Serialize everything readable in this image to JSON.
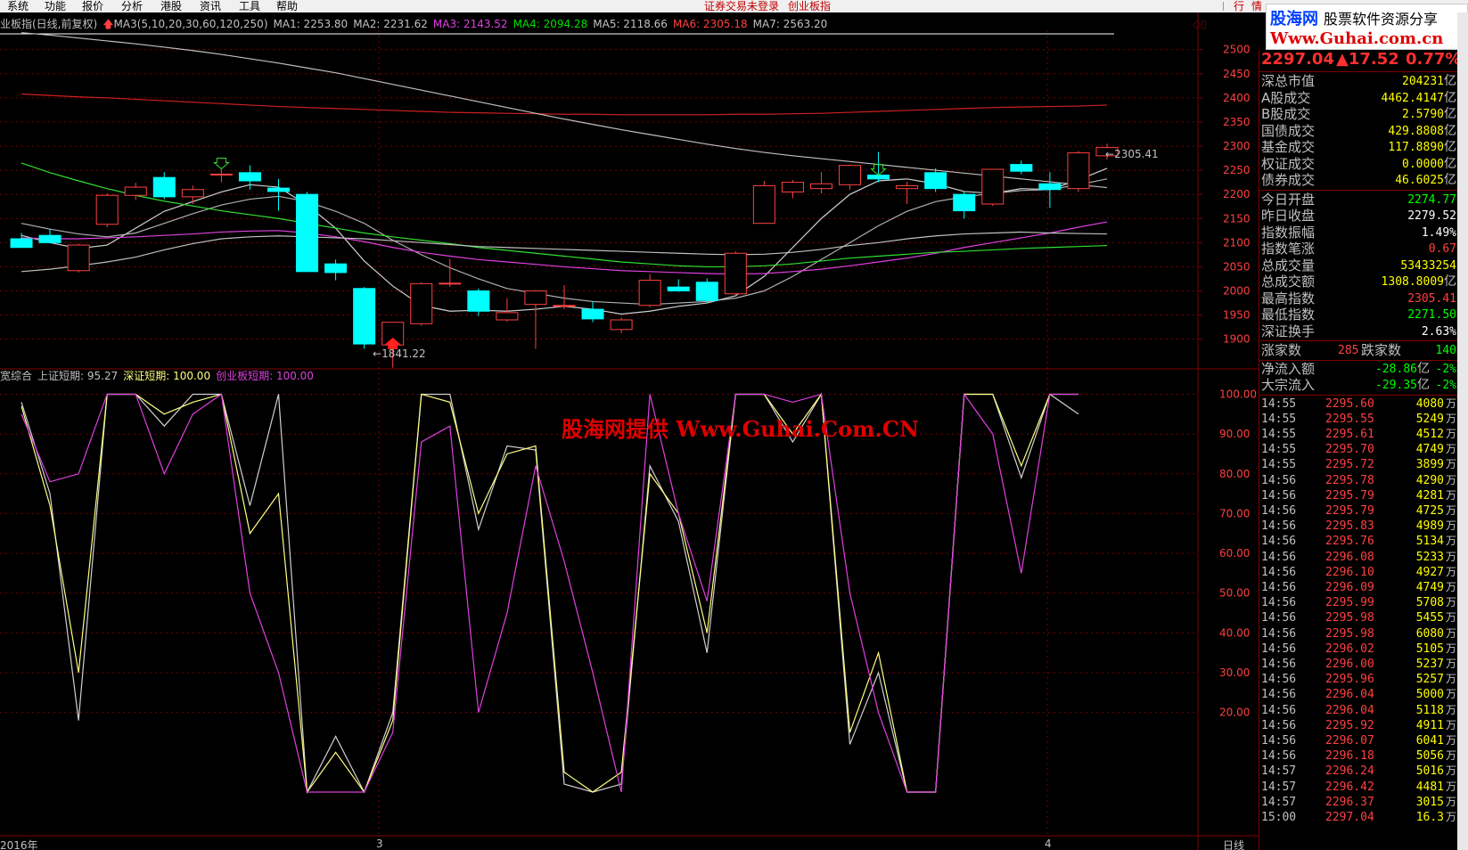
{
  "menu": {
    "items": [
      "系统",
      "功能",
      "报价",
      "分析",
      "港股",
      "资讯",
      "工具",
      "帮助"
    ],
    "status_text": "证券交易未登录",
    "status_text2": "创业板指",
    "right_items": [
      "行",
      "情"
    ]
  },
  "logo": {
    "line1_a": "股海网",
    "line1_b": "股票软件资源分享",
    "line2": "Www.Guhai.com.cn"
  },
  "main_legend": {
    "title": "业板指(日线,前复权)",
    "ma_label": "MA3(5,10,20,30,60,120,250)",
    "items": [
      {
        "text": "MA1: 2253.80",
        "color": "#c0c0c0"
      },
      {
        "text": "MA2: 2231.62",
        "color": "#c0c0c0"
      },
      {
        "text": "MA3: 2143.52",
        "color": "#e040e0"
      },
      {
        "text": "MA4: 2094.28",
        "color": "#00e000"
      },
      {
        "text": "MA5: 2118.66",
        "color": "#c0c0c0"
      },
      {
        "text": "MA6: 2305.18",
        "color": "#ff4040"
      },
      {
        "text": "MA7: 2563.20",
        "color": "#c0c0c0"
      }
    ]
  },
  "sub_legend": {
    "title": "宽综合",
    "items": [
      {
        "text": "上证短期: 95.27",
        "color": "#c0c0c0"
      },
      {
        "text": "深证短期: 100.00",
        "color": "#ffff80"
      },
      {
        "text": "创业板短期: 100.00",
        "color": "#e040e0"
      }
    ]
  },
  "annotations": {
    "low_label": "1841.22",
    "high_label": "2305.41",
    "period": "日线",
    "date_left": "2016年",
    "month_3": "3",
    "month_4": "4"
  },
  "watermark": {
    "part1": "股海网提供",
    "part2": "Www.Guhai.Com.CN"
  },
  "colors": {
    "up": "#ff4040",
    "down": "#00ffff",
    "grid": "#800000",
    "bg": "#000000"
  },
  "panel": {
    "price": "2297.04",
    "change": "▲17.52",
    "change_pct": "0.77%",
    "stats": [
      {
        "label": "深总市值",
        "value": "204231",
        "unit": "亿",
        "color": "#ffff00"
      },
      {
        "label": "A股成交",
        "value": "4462.4147",
        "unit": "亿",
        "color": "#ffff00"
      },
      {
        "label": "B股成交",
        "value": "2.5790",
        "unit": "亿",
        "color": "#ffff00"
      },
      {
        "label": "国债成交",
        "value": "429.8808",
        "unit": "亿",
        "color": "#ffff00"
      },
      {
        "label": "基金成交",
        "value": "117.8890",
        "unit": "亿",
        "color": "#ffff00"
      },
      {
        "label": "权证成交",
        "value": "0.0000",
        "unit": "亿",
        "color": "#ffff00"
      },
      {
        "label": "债券成交",
        "value": "46.6025",
        "unit": "亿",
        "color": "#ffff00"
      }
    ],
    "stats2": [
      {
        "label": "今日开盘",
        "value": "2274.77",
        "color": "#00ff00"
      },
      {
        "label": "昨日收盘",
        "value": "2279.52",
        "color": "#ffffff"
      },
      {
        "label": "指数振幅",
        "value": "1.49%",
        "color": "#ffffff"
      },
      {
        "label": "指数笔涨",
        "value": "0.67",
        "color": "#ff4040"
      },
      {
        "label": "总成交量",
        "value": "53433254",
        "color": "#ffff00"
      },
      {
        "label": "总成交额",
        "value": "1308.8009",
        "unit": "亿",
        "color": "#ffff00"
      },
      {
        "label": "最高指数",
        "value": "2305.41",
        "color": "#ff4040"
      },
      {
        "label": "最低指数",
        "value": "2271.50",
        "color": "#00ff00"
      },
      {
        "label": "深证换手",
        "value": "2.63%",
        "color": "#ffffff"
      }
    ],
    "updown": {
      "up_label": "涨家数",
      "up_value": "285",
      "down_label": "跌家数",
      "down_value": "140"
    },
    "flows": [
      {
        "label": "净流入额",
        "value": "-28.86",
        "unit": "亿",
        "pct": "-2%"
      },
      {
        "label": "大宗流入",
        "value": "-29.35",
        "unit": "亿",
        "pct": "-2%"
      }
    ],
    "ticks": [
      {
        "t": "14:55",
        "p": "2295.60",
        "v": "4080"
      },
      {
        "t": "14:55",
        "p": "2295.55",
        "v": "5249"
      },
      {
        "t": "14:55",
        "p": "2295.61",
        "v": "4512"
      },
      {
        "t": "14:55",
        "p": "2295.70",
        "v": "4749"
      },
      {
        "t": "14:55",
        "p": "2295.72",
        "v": "3899"
      },
      {
        "t": "14:56",
        "p": "2295.78",
        "v": "4290"
      },
      {
        "t": "14:56",
        "p": "2295.79",
        "v": "4281"
      },
      {
        "t": "14:56",
        "p": "2295.79",
        "v": "4725"
      },
      {
        "t": "14:56",
        "p": "2295.83",
        "v": "4989"
      },
      {
        "t": "14:56",
        "p": "2295.76",
        "v": "5134"
      },
      {
        "t": "14:56",
        "p": "2296.08",
        "v": "5233"
      },
      {
        "t": "14:56",
        "p": "2296.10",
        "v": "4927"
      },
      {
        "t": "14:56",
        "p": "2296.09",
        "v": "4749"
      },
      {
        "t": "14:56",
        "p": "2295.99",
        "v": "5708"
      },
      {
        "t": "14:56",
        "p": "2295.98",
        "v": "5455"
      },
      {
        "t": "14:56",
        "p": "2295.98",
        "v": "6080"
      },
      {
        "t": "14:56",
        "p": "2296.02",
        "v": "5105"
      },
      {
        "t": "14:56",
        "p": "2296.00",
        "v": "5237"
      },
      {
        "t": "14:56",
        "p": "2295.96",
        "v": "5257"
      },
      {
        "t": "14:56",
        "p": "2296.04",
        "v": "5000"
      },
      {
        "t": "14:56",
        "p": "2296.04",
        "v": "5118"
      },
      {
        "t": "14:56",
        "p": "2295.92",
        "v": "4911"
      },
      {
        "t": "14:56",
        "p": "2296.07",
        "v": "6041"
      },
      {
        "t": "14:56",
        "p": "2296.18",
        "v": "5056"
      },
      {
        "t": "14:57",
        "p": "2296.24",
        "v": "5016"
      },
      {
        "t": "14:57",
        "p": "2296.42",
        "v": "4481"
      },
      {
        "t": "14:57",
        "p": "2296.37",
        "v": "3015"
      }
    ],
    "tick_unit": "万",
    "last_partial": {
      "t": "15:00",
      "p": "2297.04",
      "v": "16.3"
    }
  },
  "chart_data": {
    "type": "candlestick",
    "main_axis": {
      "ticks": [
        1900,
        1950,
        2000,
        2050,
        2100,
        2150,
        2200,
        2250,
        2300,
        2350,
        2400,
        2450,
        2500
      ],
      "ylim": [
        1820,
        2540
      ]
    },
    "candles": [
      {
        "o": 2108,
        "h": 2120,
        "l": 2090,
        "c": 2090
      },
      {
        "o": 2115,
        "h": 2128,
        "l": 2100,
        "c": 2100
      },
      {
        "o": 2042,
        "h": 2098,
        "l": 2038,
        "c": 2095
      },
      {
        "o": 2138,
        "h": 2202,
        "l": 2132,
        "c": 2198
      },
      {
        "o": 2198,
        "h": 2224,
        "l": 2188,
        "c": 2215
      },
      {
        "o": 2235,
        "h": 2246,
        "l": 2190,
        "c": 2195
      },
      {
        "o": 2195,
        "h": 2218,
        "l": 2180,
        "c": 2210
      },
      {
        "o": 2242,
        "h": 2252,
        "l": 2225,
        "c": 2242
      },
      {
        "o": 2245,
        "h": 2260,
        "l": 2210,
        "c": 2228
      },
      {
        "o": 2213,
        "h": 2232,
        "l": 2166,
        "c": 2206
      },
      {
        "o": 2200,
        "h": 2205,
        "l": 2040,
        "c": 2040
      },
      {
        "o": 2056,
        "h": 2065,
        "l": 2022,
        "c": 2038
      },
      {
        "o": 2005,
        "h": 2008,
        "l": 1880,
        "c": 1890
      },
      {
        "o": 1888,
        "h": 1935,
        "l": 1841,
        "c": 1935
      },
      {
        "o": 1932,
        "h": 2018,
        "l": 1928,
        "c": 2015
      },
      {
        "o": 2015,
        "h": 2066,
        "l": 2008,
        "c": 2016
      },
      {
        "o": 2000,
        "h": 2005,
        "l": 1948,
        "c": 1958
      },
      {
        "o": 1940,
        "h": 1985,
        "l": 1936,
        "c": 1955
      },
      {
        "o": 1972,
        "h": 2002,
        "l": 1880,
        "c": 2000
      },
      {
        "o": 1968,
        "h": 2012,
        "l": 1962,
        "c": 1970
      },
      {
        "o": 1962,
        "h": 1978,
        "l": 1935,
        "c": 1942
      },
      {
        "o": 1920,
        "h": 1945,
        "l": 1912,
        "c": 1940
      },
      {
        "o": 1970,
        "h": 2035,
        "l": 1966,
        "c": 2022
      },
      {
        "o": 2008,
        "h": 2024,
        "l": 1998,
        "c": 2000
      },
      {
        "o": 2018,
        "h": 2026,
        "l": 1975,
        "c": 1980
      },
      {
        "o": 1994,
        "h": 2082,
        "l": 1990,
        "c": 2078
      },
      {
        "o": 2140,
        "h": 2228,
        "l": 2140,
        "c": 2218
      },
      {
        "o": 2205,
        "h": 2230,
        "l": 2192,
        "c": 2225
      },
      {
        "o": 2212,
        "h": 2246,
        "l": 2202,
        "c": 2222
      },
      {
        "o": 2220,
        "h": 2262,
        "l": 2210,
        "c": 2260
      },
      {
        "o": 2240,
        "h": 2288,
        "l": 2225,
        "c": 2232
      },
      {
        "o": 2212,
        "h": 2226,
        "l": 2180,
        "c": 2218
      },
      {
        "o": 2245,
        "h": 2254,
        "l": 2205,
        "c": 2212
      },
      {
        "o": 2200,
        "h": 2206,
        "l": 2150,
        "c": 2166
      },
      {
        "o": 2180,
        "h": 2252,
        "l": 2176,
        "c": 2252
      },
      {
        "o": 2262,
        "h": 2270,
        "l": 2242,
        "c": 2248
      },
      {
        "o": 2222,
        "h": 2246,
        "l": 2172,
        "c": 2210
      },
      {
        "o": 2212,
        "h": 2290,
        "l": 2205,
        "c": 2286
      },
      {
        "o": 2280,
        "h": 2305,
        "l": 2272,
        "c": 2297
      }
    ],
    "ma_lines": [
      {
        "name": "MA1",
        "color": "#d0d0d0",
        "values": [
          2115,
          2100,
          2088,
          2095,
          2130,
          2165,
          2185,
          2205,
          2220,
          2215,
          2178,
          2130,
          2062,
          2010,
          1970,
          1958,
          1960,
          1958,
          1962,
          1968,
          1962,
          1952,
          1958,
          1968,
          1975,
          1990,
          2030,
          2090,
          2150,
          2200,
          2228,
          2232,
          2222,
          2206,
          2202,
          2212,
          2210,
          2230,
          2254
        ]
      },
      {
        "name": "MA2",
        "color": "#b0b0b0",
        "values": [
          2140,
          2128,
          2118,
          2112,
          2120,
          2140,
          2160,
          2178,
          2190,
          2196,
          2185,
          2165,
          2140,
          2105,
          2075,
          2048,
          2025,
          2005,
          1995,
          1985,
          1978,
          1975,
          1972,
          1975,
          1978,
          1985,
          2000,
          2030,
          2065,
          2100,
          2135,
          2165,
          2185,
          2195,
          2202,
          2208,
          2210,
          2220,
          2232
        ]
      },
      {
        "name": "MA3",
        "color": "#e040e0",
        "values": [
          2110,
          2108,
          2108,
          2110,
          2112,
          2115,
          2118,
          2122,
          2124,
          2125,
          2120,
          2112,
          2102,
          2090,
          2080,
          2072,
          2065,
          2060,
          2055,
          2050,
          2046,
          2042,
          2040,
          2038,
          2036,
          2035,
          2036,
          2040,
          2045,
          2052,
          2060,
          2068,
          2078,
          2090,
          2100,
          2110,
          2120,
          2132,
          2143
        ]
      },
      {
        "name": "MA4",
        "color": "#30e030",
        "values": [
          2265,
          2245,
          2228,
          2212,
          2198,
          2186,
          2176,
          2166,
          2158,
          2150,
          2140,
          2130,
          2120,
          2112,
          2105,
          2098,
          2090,
          2084,
          2078,
          2072,
          2066,
          2060,
          2056,
          2052,
          2050,
          2050,
          2052,
          2056,
          2062,
          2068,
          2072,
          2076,
          2080,
          2082,
          2085,
          2088,
          2090,
          2092,
          2094
        ]
      },
      {
        "name": "MA5",
        "color": "#c0c0c0",
        "values": [
          2040,
          2045,
          2052,
          2060,
          2070,
          2085,
          2098,
          2108,
          2112,
          2114,
          2112,
          2110,
          2108,
          2104,
          2100,
          2096,
          2092,
          2090,
          2088,
          2086,
          2084,
          2082,
          2080,
          2078,
          2076,
          2075,
          2076,
          2080,
          2086,
          2094,
          2100,
          2108,
          2114,
          2118,
          2120,
          2122,
          2120,
          2119,
          2118
        ]
      },
      {
        "name": "MA6",
        "color": "#d02020",
        "values": [
          2408,
          2405,
          2402,
          2400,
          2397,
          2394,
          2391,
          2388,
          2385,
          2382,
          2380,
          2378,
          2376,
          2374,
          2372,
          2370,
          2369,
          2368,
          2367,
          2366,
          2366,
          2365,
          2365,
          2365,
          2365,
          2366,
          2366,
          2367,
          2368,
          2370,
          2372,
          2374,
          2376,
          2378,
          2380,
          2381,
          2382,
          2383,
          2385
        ]
      },
      {
        "name": "MA7",
        "color": "#c0c0c0",
        "values": [
          2535,
          2530,
          2524,
          2518,
          2512,
          2505,
          2498,
          2490,
          2481,
          2472,
          2462,
          2452,
          2440,
          2428,
          2416,
          2404,
          2392,
          2380,
          2368,
          2356,
          2345,
          2334,
          2324,
          2314,
          2304,
          2295,
          2287,
          2280,
          2274,
          2268,
          2262,
          2256,
          2250,
          2244,
          2238,
          2232,
          2226,
          2220,
          2214
        ]
      }
    ],
    "sub_axis": {
      "ticks": [
        20,
        30,
        40,
        50,
        60,
        70,
        80,
        90,
        100
      ],
      "ylim": [
        0,
        101
      ]
    },
    "sub_series": [
      {
        "name": "上证短期",
        "color": "#d0d0d0",
        "values": [
          98,
          75,
          18,
          100,
          100,
          92,
          100,
          100,
          72,
          100,
          0,
          14,
          0,
          20,
          100,
          100,
          66,
          87,
          86,
          2,
          0,
          2,
          82,
          68,
          35,
          100,
          100,
          88,
          100,
          12,
          30,
          0,
          0,
          100,
          100,
          79,
          100,
          95
        ]
      },
      {
        "name": "深证短期",
        "color": "#ffff80",
        "values": [
          97,
          72,
          30,
          100,
          100,
          95,
          98,
          100,
          65,
          75,
          0,
          10,
          0,
          18,
          100,
          98,
          70,
          85,
          87,
          5,
          0,
          5,
          80,
          70,
          40,
          100,
          100,
          90,
          100,
          15,
          35,
          0,
          0,
          100,
          100,
          82,
          100,
          100
        ]
      },
      {
        "name": "创业板短期",
        "color": "#e040e0",
        "values": [
          95,
          78,
          80,
          100,
          100,
          80,
          95,
          100,
          50,
          30,
          0,
          0,
          0,
          15,
          88,
          92,
          20,
          45,
          82,
          58,
          30,
          0,
          100,
          70,
          48,
          100,
          100,
          98,
          100,
          50,
          20,
          0,
          0,
          100,
          90,
          55,
          100,
          100
        ]
      }
    ]
  }
}
